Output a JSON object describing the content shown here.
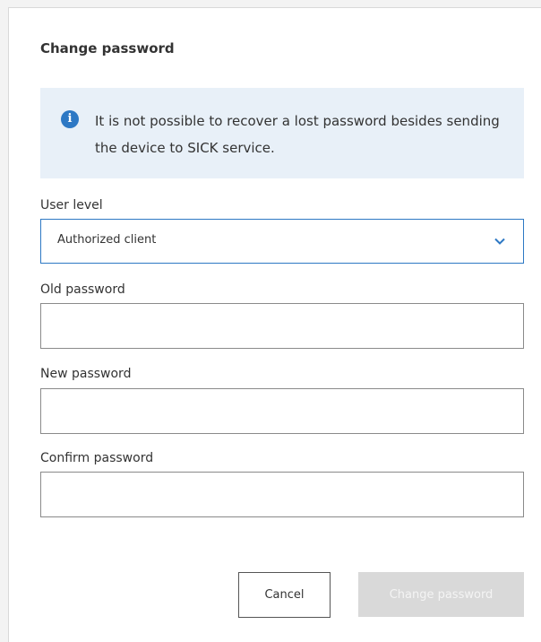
{
  "dialog": {
    "title": "Change password",
    "info": {
      "icon": "info-icon",
      "text": "It is not possible to recover a lost password besides sending the device to SICK service."
    },
    "user_level": {
      "label": "User level",
      "selected": "Authorized client",
      "icon": "chevron-down-icon"
    },
    "old_password": {
      "label": "Old password",
      "value": ""
    },
    "new_password": {
      "label": "New password",
      "value": ""
    },
    "confirm_password": {
      "label": "Confirm password",
      "value": ""
    },
    "buttons": {
      "cancel_label": "Cancel",
      "submit_label": "Change password"
    }
  },
  "colors": {
    "accent": "#2d78c4",
    "info_background": "#e8f0f8",
    "disabled_button": "#d9d9d9"
  }
}
